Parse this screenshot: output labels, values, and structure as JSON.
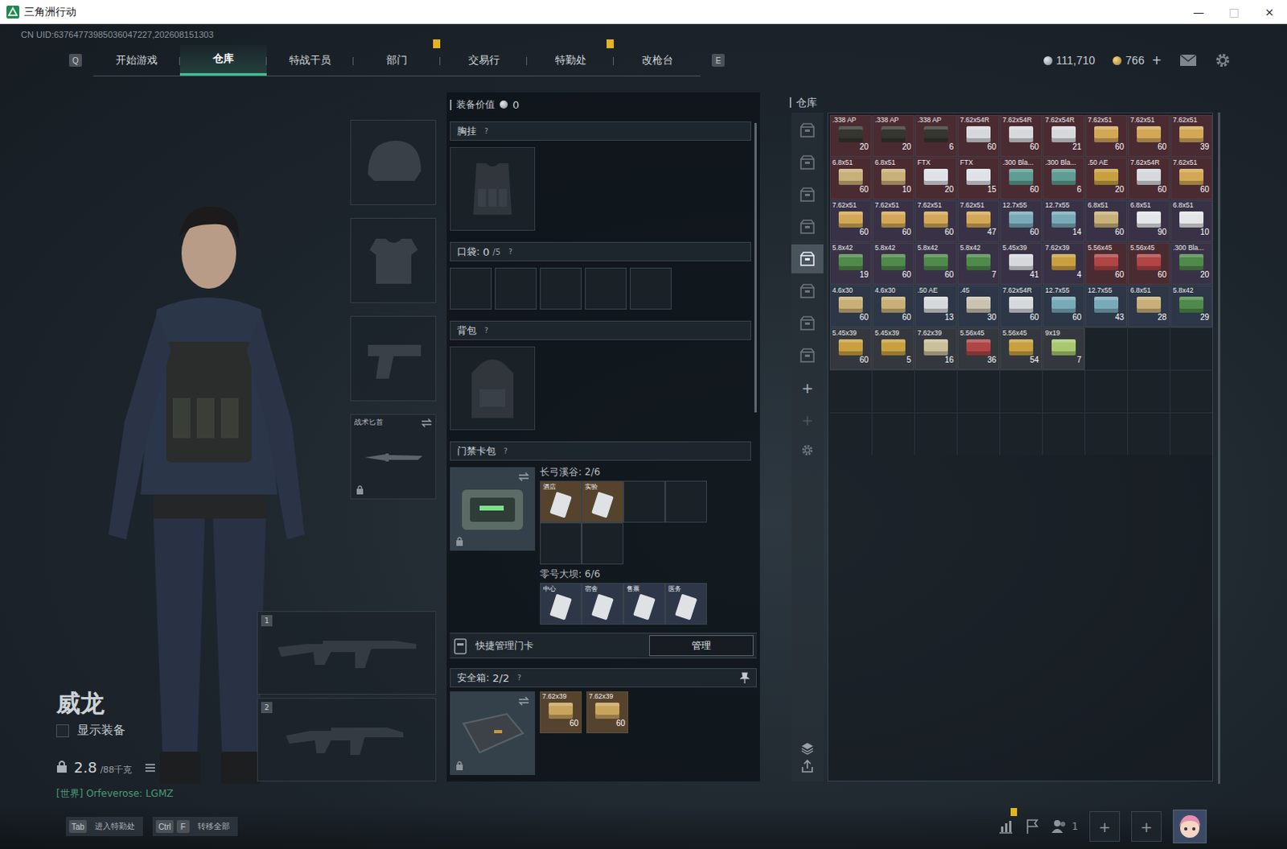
{
  "window": {
    "title": "三角洲行动",
    "controls": [
      "—",
      "□",
      "×"
    ]
  },
  "uid": "CN UID:63764773985036047227,202608151303",
  "nav": {
    "prevKey": "Q",
    "nextKey": "E",
    "tabs": [
      {
        "label": "开始游戏",
        "selected": false,
        "alert": false
      },
      {
        "label": "仓库",
        "selected": true,
        "alert": false
      },
      {
        "label": "特战干员",
        "selected": false,
        "alert": false
      },
      {
        "label": "部门",
        "selected": false,
        "alert": true
      },
      {
        "label": "交易行",
        "selected": false,
        "alert": false
      },
      {
        "label": "特勤处",
        "selected": false,
        "alert": true
      },
      {
        "label": "改枪台",
        "selected": false,
        "alert": false
      }
    ]
  },
  "currency": {
    "coin": "111,710",
    "token": "766",
    "tokenAdd": "+"
  },
  "operator": {
    "name": "威龙",
    "showGear": {
      "label": "显示装备",
      "checked": false
    },
    "weight": "2.8",
    "capacity": "/88千克",
    "chat": "[世界] Orfeverose: LGMZ"
  },
  "gearSlots": [
    {
      "kind": "helmet",
      "label": "",
      "locked": false,
      "swap": false
    },
    {
      "kind": "armor",
      "label": "",
      "locked": false,
      "swap": false
    },
    {
      "kind": "pistol",
      "label": "",
      "locked": false,
      "swap": false
    },
    {
      "kind": "knife",
      "label": "战术匕首",
      "locked": true,
      "swap": true
    }
  ],
  "weaponSlots": [
    {
      "number": "1",
      "kind": "rifle"
    },
    {
      "number": "2",
      "kind": "smg"
    }
  ],
  "loadout": {
    "valueLabel": "装备价值",
    "value": "0",
    "chestRig": {
      "title": "胸挂",
      "help": "?"
    },
    "pockets": {
      "title": "口袋:",
      "used": "0",
      "capacity": "/5",
      "help": "?",
      "cells": 5
    },
    "backpack": {
      "title": "背包",
      "help": "?"
    },
    "keycards": {
      "title": "门禁卡包",
      "help": "?",
      "locked": true,
      "maps": [
        {
          "label": "长弓溪谷: 2/6",
          "cells": 6,
          "cards": [
            {
              "name": "酒店",
              "rarity": "gold"
            },
            {
              "name": "实验",
              "rarity": "gold"
            }
          ]
        },
        {
          "label": "零号大坝: 6/6",
          "cells": 4,
          "cards": [
            {
              "name": "中心",
              "rarity": "blue"
            },
            {
              "name": "宿舍",
              "rarity": "blue"
            },
            {
              "name": "售票",
              "rarity": "blue"
            },
            {
              "name": "医务",
              "rarity": "blue"
            }
          ]
        }
      ]
    },
    "quickManage": {
      "label": "快捷管理门卡",
      "button": "管理"
    },
    "safeBox": {
      "title": "安全箱:",
      "count": "2/2",
      "help": "?",
      "pinned": true,
      "locked": true,
      "items": [
        {
          "name": "7.62x39",
          "count": "60",
          "rarity": "gold",
          "color": "#c9a45c"
        },
        {
          "name": "7.62x39",
          "count": "60",
          "rarity": "gold",
          "color": "#c9a45c"
        }
      ]
    }
  },
  "warehouse": {
    "title": "仓库",
    "tabs": [
      {
        "selected": false
      },
      {
        "selected": false
      },
      {
        "selected": false
      },
      {
        "selected": false
      },
      {
        "selected": true
      },
      {
        "selected": false
      },
      {
        "selected": false
      },
      {
        "selected": false
      }
    ],
    "addButtons": [
      {
        "label": "+",
        "disabled": false
      },
      {
        "label": "+",
        "disabled": true
      }
    ],
    "items": [
      {
        "name": ".338 AP",
        "count": "20",
        "rarity": "red",
        "color": "#34362f"
      },
      {
        "name": ".338 AP",
        "count": "20",
        "rarity": "red",
        "color": "#34362f"
      },
      {
        "name": ".338 AP",
        "count": "6",
        "rarity": "red",
        "color": "#34362f"
      },
      {
        "name": "7.62x54R",
        "count": "60",
        "rarity": "red",
        "color": "#d6d9dc"
      },
      {
        "name": "7.62x54R",
        "count": "60",
        "rarity": "red",
        "color": "#d6d9dc"
      },
      {
        "name": "7.62x54R",
        "count": "21",
        "rarity": "red",
        "color": "#d6d9dc"
      },
      {
        "name": "7.62x51",
        "count": "60",
        "rarity": "red",
        "color": "#d2a857"
      },
      {
        "name": "7.62x51",
        "count": "60",
        "rarity": "red",
        "color": "#d2a857"
      },
      {
        "name": "7.62x51",
        "count": "39",
        "rarity": "red",
        "color": "#d2a857"
      },
      {
        "name": "6.8x51",
        "count": "60",
        "rarity": "red",
        "color": "#c8b078"
      },
      {
        "name": "6.8x51",
        "count": "10",
        "rarity": "red",
        "color": "#c8b078"
      },
      {
        "name": "FTX",
        "count": "20",
        "rarity": "red",
        "color": "#dfe2e6"
      },
      {
        "name": "FTX",
        "count": "15",
        "rarity": "red",
        "color": "#dfe2e6"
      },
      {
        "name": ".300 Bla...",
        "count": "60",
        "rarity": "red",
        "color": "#5f9c93"
      },
      {
        "name": ".300 Bla...",
        "count": "6",
        "rarity": "red",
        "color": "#5f9c93"
      },
      {
        "name": ".50 AE",
        "count": "20",
        "rarity": "red",
        "color": "#c8a040"
      },
      {
        "name": "7.62x54R",
        "count": "60",
        "rarity": "red",
        "color": "#d6d9dc"
      },
      {
        "name": "7.62x51",
        "count": "60",
        "rarity": "red",
        "color": "#d2a857"
      },
      {
        "name": "7.62x51",
        "count": "60",
        "rarity": "purple",
        "color": "#d2a857"
      },
      {
        "name": "7.62x51",
        "count": "60",
        "rarity": "purple",
        "color": "#d2a857"
      },
      {
        "name": "7.62x51",
        "count": "60",
        "rarity": "purple",
        "color": "#d2a857"
      },
      {
        "name": "7.62x51",
        "count": "47",
        "rarity": "purple",
        "color": "#d2a857"
      },
      {
        "name": "12.7x55",
        "count": "60",
        "rarity": "purple",
        "color": "#79aab8"
      },
      {
        "name": "12.7x55",
        "count": "14",
        "rarity": "purple",
        "color": "#79aab8"
      },
      {
        "name": "6.8x51",
        "count": "60",
        "rarity": "purple",
        "color": "#c8b078"
      },
      {
        "name": "6.8x51",
        "count": "90",
        "rarity": "purple",
        "color": "#e4e6e8"
      },
      {
        "name": "6.8x51",
        "count": "10",
        "rarity": "purple",
        "color": "#e4e6e8"
      },
      {
        "name": "5.8x42",
        "count": "19",
        "rarity": "purple",
        "color": "#4f8a4a"
      },
      {
        "name": "5.8x42",
        "count": "60",
        "rarity": "purple",
        "color": "#4f8a4a"
      },
      {
        "name": "5.8x42",
        "count": "60",
        "rarity": "purple",
        "color": "#4f8a4a"
      },
      {
        "name": "5.8x42",
        "count": "7",
        "rarity": "purple",
        "color": "#4f8a4a"
      },
      {
        "name": "5.45x39",
        "count": "41",
        "rarity": "purple",
        "color": "#d6d9dc"
      },
      {
        "name": "7.62x39",
        "count": "4",
        "rarity": "purple",
        "color": "#c8a040"
      },
      {
        "name": "5.56x45",
        "count": "60",
        "rarity": "red",
        "color": "#b04545"
      },
      {
        "name": "5.56x45",
        "count": "60",
        "rarity": "red",
        "color": "#b04545"
      },
      {
        "name": ".300 Bla...",
        "count": "20",
        "rarity": "purple",
        "color": "#4f8a4a"
      },
      {
        "name": "4.6x30",
        "count": "60",
        "rarity": "blue",
        "color": "#c8b078"
      },
      {
        "name": "4.6x30",
        "count": "60",
        "rarity": "blue",
        "color": "#c8b078"
      },
      {
        "name": ".50 AE",
        "count": "13",
        "rarity": "blue",
        "color": "#d6d9dc"
      },
      {
        "name": ".45",
        "count": "30",
        "rarity": "blue",
        "color": "#c9c3b0"
      },
      {
        "name": "7.62x54R",
        "count": "60",
        "rarity": "blue",
        "color": "#d6d9dc"
      },
      {
        "name": "12.7x55",
        "count": "60",
        "rarity": "blue",
        "color": "#79aab8"
      },
      {
        "name": "12.7x55",
        "count": "43",
        "rarity": "blue",
        "color": "#79aab8"
      },
      {
        "name": "6.8x51",
        "count": "28",
        "rarity": "blue",
        "color": "#c8b078"
      },
      {
        "name": "5.8x42",
        "count": "29",
        "rarity": "blue",
        "color": "#4f8a4a"
      },
      {
        "name": "5.45x39",
        "count": "60",
        "rarity": "gray",
        "color": "#c8a040"
      },
      {
        "name": "5.45x39",
        "count": "5",
        "rarity": "gray",
        "color": "#c8a040"
      },
      {
        "name": "7.62x39",
        "count": "16",
        "rarity": "gray",
        "color": "#c9bf98"
      },
      {
        "name": "5.56x45",
        "count": "36",
        "rarity": "gray",
        "color": "#b04545"
      },
      {
        "name": "5.56x45",
        "count": "54",
        "rarity": "gray",
        "color": "#c8a040"
      },
      {
        "name": "9x19",
        "count": "7",
        "rarity": "gray",
        "color": "#a8c870"
      }
    ]
  },
  "hotkeys": [
    {
      "keys": [
        "Tab"
      ],
      "label": "进入特勤处"
    },
    {
      "keys": [
        "Ctrl",
        "F"
      ],
      "label": "转移全部"
    }
  ],
  "social": {
    "statsAlert": true,
    "friends": "1",
    "invite": [
      "+",
      "+"
    ]
  }
}
